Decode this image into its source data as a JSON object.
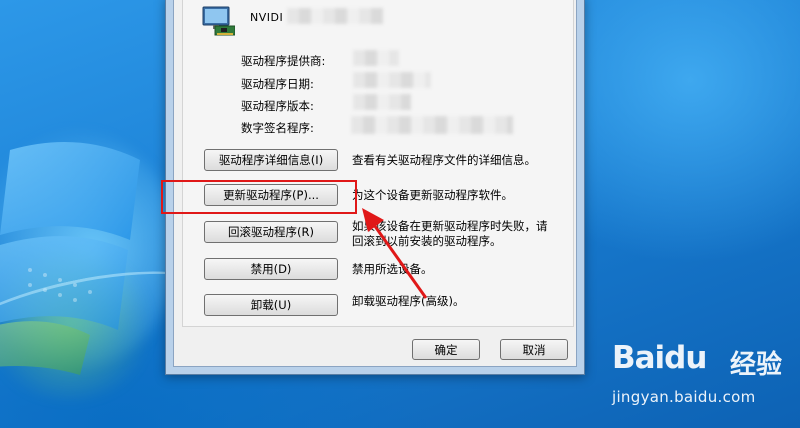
{
  "device": {
    "name_visible": "NVIDI"
  },
  "properties": [
    {
      "label": "驱动程序提供商:"
    },
    {
      "label": "驱动程序日期:"
    },
    {
      "label": "驱动程序版本:"
    },
    {
      "label": "数字签名程序:"
    }
  ],
  "actions": [
    {
      "button": "驱动程序详细信息(I)",
      "description": "查看有关驱动程序文件的详细信息。"
    },
    {
      "button": "更新驱动程序(P)...",
      "description": "为这个设备更新驱动程序软件。"
    },
    {
      "button": "回滚驱动程序(R)",
      "description_line1": "如果该设备在更新驱动程序时失败，请",
      "description_line2": "回滚到以前安装的驱动程序。"
    },
    {
      "button": "禁用(D)",
      "description": "禁用所选设备。"
    },
    {
      "button": "卸载(U)",
      "description": "卸载驱动程序(高级)。"
    }
  ],
  "footer": {
    "ok_label": "确定",
    "cancel_label": "取消"
  },
  "watermark": {
    "brand": "Baidu",
    "brand_cn": "经验",
    "url": "jingyan.baidu.com"
  },
  "colors": {
    "highlight": "#e01818",
    "desktop": "#1a7fd4"
  }
}
